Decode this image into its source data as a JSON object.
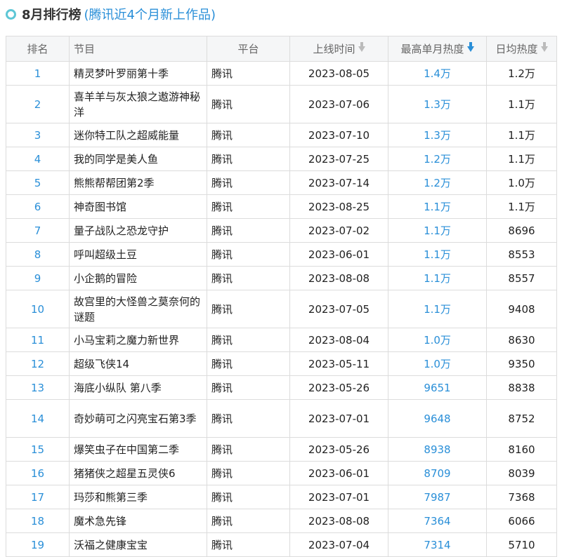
{
  "header": {
    "title": "8月排行榜",
    "subtitle": "(腾讯近4个月新上作品)"
  },
  "columns": {
    "rank": "排名",
    "title": "节目",
    "platform": "平台",
    "launch": "上线时间",
    "peak": "最高单月热度",
    "daily": "日均热度"
  },
  "rows": [
    {
      "rank": "1",
      "title": "精灵梦叶罗丽第十季",
      "platform": "腾讯",
      "launch": "2023-08-05",
      "peak": "1.4万",
      "daily": "1.2万"
    },
    {
      "rank": "2",
      "title": "喜羊羊与灰太狼之遨游神秘洋",
      "platform": "腾讯",
      "launch": "2023-07-06",
      "peak": "1.3万",
      "daily": "1.1万"
    },
    {
      "rank": "3",
      "title": "迷你特工队之超威能量",
      "platform": "腾讯",
      "launch": "2023-07-10",
      "peak": "1.3万",
      "daily": "1.1万"
    },
    {
      "rank": "4",
      "title": "我的同学是美人鱼",
      "platform": "腾讯",
      "launch": "2023-07-25",
      "peak": "1.2万",
      "daily": "1.1万"
    },
    {
      "rank": "5",
      "title": "熊熊帮帮团第2季",
      "platform": "腾讯",
      "launch": "2023-07-14",
      "peak": "1.2万",
      "daily": "1.0万"
    },
    {
      "rank": "6",
      "title": "神奇图书馆",
      "platform": "腾讯",
      "launch": "2023-08-25",
      "peak": "1.1万",
      "daily": "1.1万"
    },
    {
      "rank": "7",
      "title": "量子战队之恐龙守护",
      "platform": "腾讯",
      "launch": "2023-07-02",
      "peak": "1.1万",
      "daily": "8696"
    },
    {
      "rank": "8",
      "title": "呼叫超级土豆",
      "platform": "腾讯",
      "launch": "2023-06-01",
      "peak": "1.1万",
      "daily": "8553"
    },
    {
      "rank": "9",
      "title": "小企鹅的冒险",
      "platform": "腾讯",
      "launch": "2023-08-08",
      "peak": "1.1万",
      "daily": "8557"
    },
    {
      "rank": "10",
      "title": "故宫里的大怪兽之莫奈何的谜题",
      "platform": "腾讯",
      "launch": "2023-07-05",
      "peak": "1.1万",
      "daily": "9408"
    },
    {
      "rank": "11",
      "title": "小马宝莉之魔力新世界",
      "platform": "腾讯",
      "launch": "2023-08-04",
      "peak": "1.0万",
      "daily": "8630"
    },
    {
      "rank": "12",
      "title": "超级飞侠14",
      "platform": "腾讯",
      "launch": "2023-05-11",
      "peak": "1.0万",
      "daily": "9350"
    },
    {
      "rank": "13",
      "title": "海底小纵队 第八季",
      "platform": "腾讯",
      "launch": "2023-05-26",
      "peak": "9651",
      "daily": "8838"
    },
    {
      "rank": "14",
      "title": "奇妙萌可之闪亮宝石第3季",
      "platform": "腾讯",
      "launch": "2023-07-01",
      "peak": "9648",
      "daily": "8752"
    },
    {
      "rank": "15",
      "title": "爆笑虫子在中国第二季",
      "platform": "腾讯",
      "launch": "2023-05-26",
      "peak": "8938",
      "daily": "8160"
    },
    {
      "rank": "16",
      "title": "猪猪侠之超星五灵侠6",
      "platform": "腾讯",
      "launch": "2023-06-01",
      "peak": "8709",
      "daily": "8039"
    },
    {
      "rank": "17",
      "title": "玛莎和熊第三季",
      "platform": "腾讯",
      "launch": "2023-07-01",
      "peak": "7987",
      "daily": "7368"
    },
    {
      "rank": "18",
      "title": "魔术急先锋",
      "platform": "腾讯",
      "launch": "2023-08-08",
      "peak": "7364",
      "daily": "6066"
    },
    {
      "rank": "19",
      "title": "沃福之健康宝宝",
      "platform": "腾讯",
      "launch": "2023-07-04",
      "peak": "7314",
      "daily": "5710"
    }
  ],
  "colors": {
    "accent": "#2a8fd8",
    "ring": "#5ec7d6",
    "header_bg": "#f5f6f7",
    "border": "#dcdcdc"
  }
}
